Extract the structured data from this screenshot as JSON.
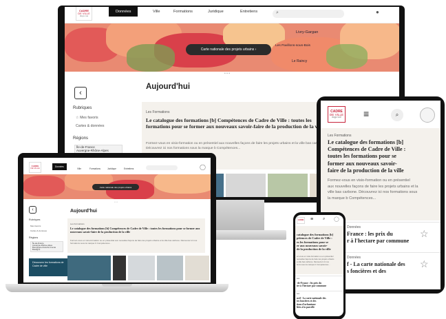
{
  "brand": {
    "line1": "CADRE",
    "line2": "DE VILLE",
    "line3": "dugo.vue"
  },
  "colors": {
    "accent_red": "#c7223a",
    "dark_nav": "#111111",
    "card_bg": "#f4f1ec",
    "cta_blue": "#1c4d63"
  },
  "nav": {
    "tabs": [
      "Données",
      "Ville",
      "Formations",
      "Juridique",
      "Entretiens"
    ],
    "active_tab": "Données",
    "search_icon": "search-icon",
    "menu_icon": "hamburger-menu-icon",
    "user_icon": "user-avatar-icon"
  },
  "map": {
    "places": [
      "Livry-Gargan",
      "Les Pavillons-sous-Bois",
      "Le Raincy"
    ],
    "cta": "Carte nationale des projets urbains",
    "cta_arrow": "›",
    "dots": "• • •"
  },
  "sidebar": {
    "back": "‹",
    "rubriques_heading": "Rubriques",
    "items": [
      "Mes favoris",
      "Cartes & données"
    ],
    "regions_heading": "Régions",
    "region_values": [
      "Île-de-France",
      "Auvergne-Rhône-Alpes"
    ],
    "region_values_laptop": [
      "Île-de-France",
      "Auvergne-Rhône-Alpes",
      "Bourgogne-Franche-Comté",
      "Bretagne"
    ],
    "cta": "Découvrez les formations de Cadre de ville"
  },
  "main": {
    "title": "Aujourd'hui",
    "card_category": "Les Formations",
    "card_title": "Le catalogue des formations [b] Compétences de Cadre de Ville : toutes les formations pour se former aux nouveaux savoir-faire de la production de la ville",
    "card_desc": "Formez-vous en visio-formation ou en présentiel aux nouvelles façons de faire les projets urbains et la ville bas carbone. Découvrez ici nos formations sous la marque b Compétences..."
  },
  "tablet": {
    "card_title_lines": [
      "Le catalogue des formations [b]",
      "Compétences de Cadre de Ville :",
      "toutes les formations pour se",
      "former aux nouveaux savoir-",
      "faire de la production de la ville"
    ],
    "desc_lines": [
      "Formez-vous en visio-formation ou en présentiel",
      "aux nouvelles façons de faire les projets urbains et la",
      "ville bas carbone. Découvrez ici nos formations sous",
      "la marque b Compétences..."
    ],
    "items": [
      {
        "category": "Données",
        "title_lines": [
          "France : les prix du",
          "r à l'hectare par commune"
        ]
      },
      {
        "category": "Données",
        "title_lines": [
          "f - La carte nationale des",
          "s foncières et des"
        ]
      }
    ],
    "star_icon": "☆"
  },
  "phone": {
    "card_title_lines": [
      "catalogue des formations [b]",
      "pétences de Cadre de Ville :",
      "es les formations pour se",
      "er aux nouveaux savoir-",
      "de la production de la ville"
    ],
    "desc_lines": [
      "ez-vous en visio-formation ou en présentiel",
      "nouvelles façons de faire les projets urbains",
      "a ville bas carbone. Découvrez ici nos",
      "tions sous la marque b Compétences..."
    ],
    "items": [
      {
        "category": "ées",
        "title_lines": [
          "-de-France : les prix du",
          "ier à l'hectare par commune"
        ]
      },
      {
        "category": "ées",
        "title_lines": [
          "ncif - La carte nationale des",
          "tes foncières et des",
          "tions d'urbanisme",
          "liées à la parcelle"
        ]
      }
    ]
  }
}
